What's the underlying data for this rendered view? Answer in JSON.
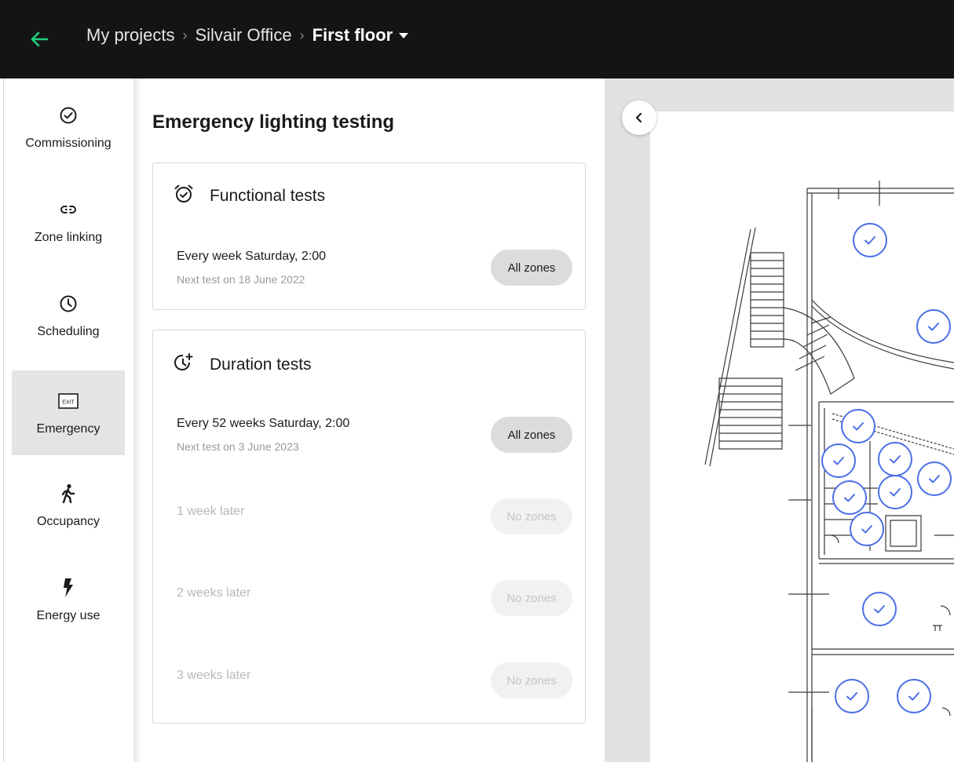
{
  "header": {
    "breadcrumbs": [
      "My projects",
      "Silvair Office"
    ],
    "current": "First floor"
  },
  "sidebar": {
    "items": [
      {
        "label": "Commissioning",
        "icon": "check-circle-icon"
      },
      {
        "label": "Zone linking",
        "icon": "link-icon"
      },
      {
        "label": "Scheduling",
        "icon": "clock-icon"
      },
      {
        "label": "Emergency",
        "icon": "exit-sign-icon",
        "active": true,
        "icon_text": "EXIT"
      },
      {
        "label": "Occupancy",
        "icon": "walking-person-icon"
      },
      {
        "label": "Energy use",
        "icon": "lightning-icon"
      }
    ]
  },
  "panel": {
    "title": "Emergency lighting testing",
    "functional": {
      "title": "Functional tests",
      "icon": "alarm-clock-check-icon",
      "schedule": "Every week Saturday, 2:00",
      "next": "Next test on 18 June 2022",
      "zones": "All zones"
    },
    "duration": {
      "title": "Duration tests",
      "icon": "clock-plus-icon",
      "schedule": "Every 52 weeks Saturday, 2:00",
      "next": "Next test on 3 June 2023",
      "zones": "All zones",
      "later": [
        {
          "label": "1 week later",
          "zones": "No zones"
        },
        {
          "label": "2 weeks later",
          "zones": "No zones"
        },
        {
          "label": "3 weeks later",
          "zones": "No zones"
        }
      ]
    }
  },
  "map": {
    "marker_color": "#4a6fe8",
    "marker_icon": "checkmark-icon",
    "collapse_icon": "chevron-left-icon"
  },
  "colors": {
    "accent_green": "#21d07a",
    "header_bg": "#141414",
    "active_nav": "#e4e4e4"
  }
}
